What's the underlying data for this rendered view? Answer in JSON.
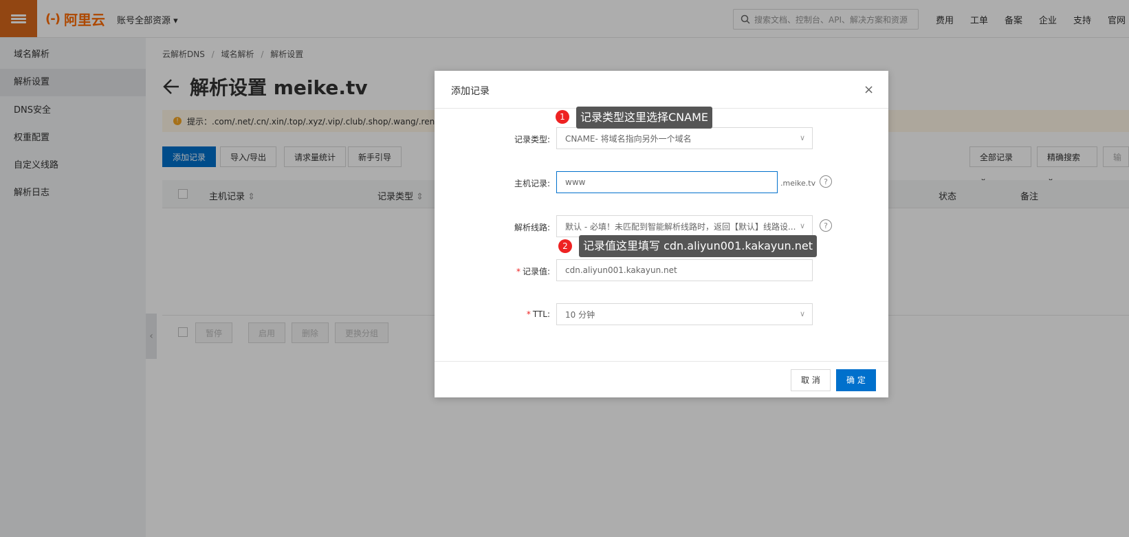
{
  "header": {
    "logo_text": "阿里云",
    "logo_bracket": "(-)",
    "account_label": "账号全部资源",
    "search_placeholder": "搜索文档、控制台、API、解决方案和资源",
    "nav": [
      "费用",
      "工单",
      "备案",
      "企业",
      "支持",
      "官网"
    ]
  },
  "sidebar": {
    "title": "域名解析",
    "items": [
      {
        "label": "解析设置",
        "active": true
      },
      {
        "label": "DNS安全"
      },
      {
        "label": "权重配置"
      },
      {
        "label": "自定义线路"
      },
      {
        "label": "解析日志"
      }
    ]
  },
  "breadcrumb": [
    "云解析DNS",
    "域名解析",
    "解析设置"
  ],
  "breadcrumb_sep": "/",
  "page": {
    "title": "解析设置 meike.tv",
    "tip_icon": "!",
    "tip": "提示：.com/.net/.cn/.xin/.top/.xyz/.vip/.club/.shop/.wang/.ren等域"
  },
  "toolbar": {
    "buttons": [
      "添加记录",
      "导入/导出",
      "请求量统计",
      "新手引导"
    ],
    "right": [
      "全部记录",
      "精确搜索",
      "输入关"
    ]
  },
  "table": {
    "headers": [
      "主机记录",
      "记录类型",
      "状态",
      "备注"
    ]
  },
  "batch_buttons": [
    "暂停",
    "启用",
    "删除",
    "更换分组"
  ],
  "modal": {
    "title": "添加记录",
    "close": "×",
    "fields": {
      "record_type": {
        "label": "记录类型:",
        "value": "CNAME- 将域名指向另外一个域名"
      },
      "host": {
        "label": "主机记录:",
        "value": "www",
        "suffix": ".meike.tv"
      },
      "line": {
        "label": "解析线路:",
        "value": "默认 - 必填！未匹配到智能解析线路时，返回【默认】线路设..."
      },
      "record_value": {
        "label": "记录值:",
        "required": true,
        "value": "cdn.aliyun001.kakayun.net"
      },
      "ttl": {
        "label": "TTL:",
        "required": true,
        "value": "10 分钟"
      }
    },
    "help": "?",
    "cancel": "取 消",
    "ok": "确 定"
  },
  "callouts": [
    {
      "num": "1",
      "text": "记录类型这里选择CNAME"
    },
    {
      "num": "2",
      "text": "记录值这里填写 cdn.aliyun001.kakayun.net"
    }
  ],
  "colors": {
    "brand": "#ff6a00",
    "primary": "#0070cc",
    "badge": "#ee2222"
  }
}
